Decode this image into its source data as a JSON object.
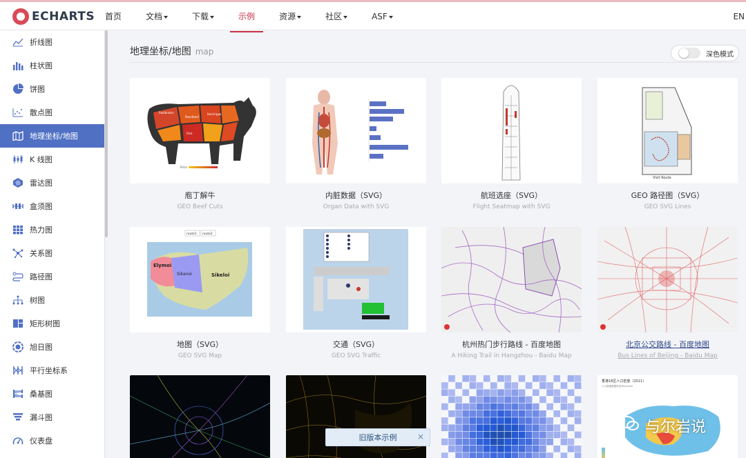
{
  "header": {
    "logo_text": "ECHARTS",
    "nav": [
      {
        "label": "首页",
        "dropdown": false,
        "active": false
      },
      {
        "label": "文档",
        "dropdown": true,
        "active": false
      },
      {
        "label": "下载",
        "dropdown": true,
        "active": false
      },
      {
        "label": "示例",
        "dropdown": false,
        "active": true
      },
      {
        "label": "资源",
        "dropdown": true,
        "active": false
      },
      {
        "label": "社区",
        "dropdown": true,
        "active": false
      },
      {
        "label": "ASF",
        "dropdown": true,
        "active": false
      }
    ],
    "lang": "EN"
  },
  "sidebar": {
    "items": [
      {
        "label": "折线图",
        "icon": "line-chart-icon"
      },
      {
        "label": "柱状图",
        "icon": "bar-chart-icon"
      },
      {
        "label": "饼图",
        "icon": "pie-chart-icon"
      },
      {
        "label": "散点图",
        "icon": "scatter-chart-icon"
      },
      {
        "label": "地理坐标/地图",
        "icon": "map-icon",
        "active": true
      },
      {
        "label": "K 线图",
        "icon": "candlestick-icon"
      },
      {
        "label": "雷达图",
        "icon": "radar-icon"
      },
      {
        "label": "盒须图",
        "icon": "boxplot-icon"
      },
      {
        "label": "热力图",
        "icon": "heatmap-icon"
      },
      {
        "label": "关系图",
        "icon": "graph-icon"
      },
      {
        "label": "路径图",
        "icon": "lines-icon"
      },
      {
        "label": "树图",
        "icon": "tree-icon"
      },
      {
        "label": "矩形树图",
        "icon": "treemap-icon"
      },
      {
        "label": "旭日图",
        "icon": "sunburst-icon"
      },
      {
        "label": "平行坐标系",
        "icon": "parallel-icon"
      },
      {
        "label": "桑基图",
        "icon": "sankey-icon"
      },
      {
        "label": "漏斗图",
        "icon": "funnel-icon"
      },
      {
        "label": "仪表盘",
        "icon": "gauge-icon"
      }
    ]
  },
  "section": {
    "title": "地理坐标/地图",
    "subtitle": "map",
    "dark_mode_label": "深色模式"
  },
  "cards": [
    {
      "title": "庖丁解牛",
      "subtitle": "GEO Beef Cuts"
    },
    {
      "title": "内脏数据（SVG）",
      "subtitle": "Organ Data with SVG"
    },
    {
      "title": "航班选座（SVG）",
      "subtitle": "Flight Seatmap with SVG"
    },
    {
      "title": "GEO 路径图（SVG）",
      "subtitle": "GEO SVG Lines"
    },
    {
      "title": "地图（SVG）",
      "subtitle": "GEO SVG Map"
    },
    {
      "title": "交通（SVG）",
      "subtitle": "GEO SVG Traffic"
    },
    {
      "title": "杭州热门步行路线 - 百度地图",
      "subtitle": "A Hiking Trail in Hangzhou - Baidu Map"
    },
    {
      "title": "北京公交路线 - 百度地图",
      "subtitle": "Bus Lines of Beijing - Baidu Map"
    },
    {
      "title": "",
      "subtitle": ""
    },
    {
      "title": "",
      "subtitle": ""
    },
    {
      "title": "",
      "subtitle": ""
    },
    {
      "title": "",
      "subtitle": ""
    }
  ],
  "thumbs": {
    "map_buttons": [
      "route1",
      "route2"
    ],
    "map_regions": [
      "Elymoi",
      "Sikanoi",
      "Sikeloi"
    ],
    "visit_route": "Visit Route",
    "population_title": "香港18区人口密度（2011）",
    "population_sub": "人口密度数据来自Wikipedia"
  },
  "toast": {
    "label": "旧版本示例",
    "close": "×"
  },
  "watermark": {
    "text": "与尔岩说"
  },
  "colors": {
    "brand": "#c92e42",
    "active_sidebar": "#5070c4"
  }
}
